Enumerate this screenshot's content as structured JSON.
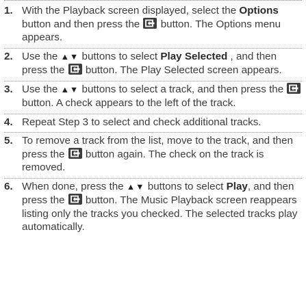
{
  "steps": [
    {
      "num": "1.",
      "parts": [
        {
          "t": "text",
          "v": "With the Playback screen displayed, select the "
        },
        {
          "t": "bold",
          "v": "Options"
        },
        {
          "t": "text",
          "v": " button and then press the "
        },
        {
          "t": "icon",
          "v": "enter-button-icon"
        },
        {
          "t": "text",
          "v": " button. The Options menu appears."
        }
      ]
    },
    {
      "num": "2.",
      "parts": [
        {
          "t": "text",
          "v": "Use the "
        },
        {
          "t": "arrows",
          "v": "▲▼"
        },
        {
          "t": "text",
          "v": " buttons to select "
        },
        {
          "t": "bold",
          "v": "Play Selected"
        },
        {
          "t": "text",
          "v": " , and then press the "
        },
        {
          "t": "icon",
          "v": "enter-button-icon"
        },
        {
          "t": "text",
          "v": " button. The Play Selected screen appears."
        }
      ]
    },
    {
      "num": "3.",
      "parts": [
        {
          "t": "text",
          "v": "Use the "
        },
        {
          "t": "arrows",
          "v": "▲▼"
        },
        {
          "t": "text",
          "v": " buttons to select a track, and then press the "
        },
        {
          "t": "icon",
          "v": "enter-button-icon"
        },
        {
          "t": "text",
          "v": " button. A check appears to the left of the track."
        }
      ]
    },
    {
      "num": "4.",
      "parts": [
        {
          "t": "text",
          "v": "Repeat Step 3 to select and check additional tracks."
        }
      ]
    },
    {
      "num": "5.",
      "parts": [
        {
          "t": "text",
          "v": "To remove a track from the list, move to the track, and then press the "
        },
        {
          "t": "icon",
          "v": "enter-button-icon"
        },
        {
          "t": "text",
          "v": " button again. The check on the track is removed."
        }
      ]
    },
    {
      "num": "6.",
      "parts": [
        {
          "t": "text",
          "v": "When done, press the "
        },
        {
          "t": "arrows",
          "v": "▲▼"
        },
        {
          "t": "text",
          "v": " buttons to select "
        },
        {
          "t": "bold",
          "v": "Play"
        },
        {
          "t": "text",
          "v": ", and then press the "
        },
        {
          "t": "icon",
          "v": "enter-button-icon"
        },
        {
          "t": "text",
          "v": " button. The Music Playback screen reappears listing only the tracks you checked. The selected tracks play automatically."
        }
      ]
    }
  ]
}
